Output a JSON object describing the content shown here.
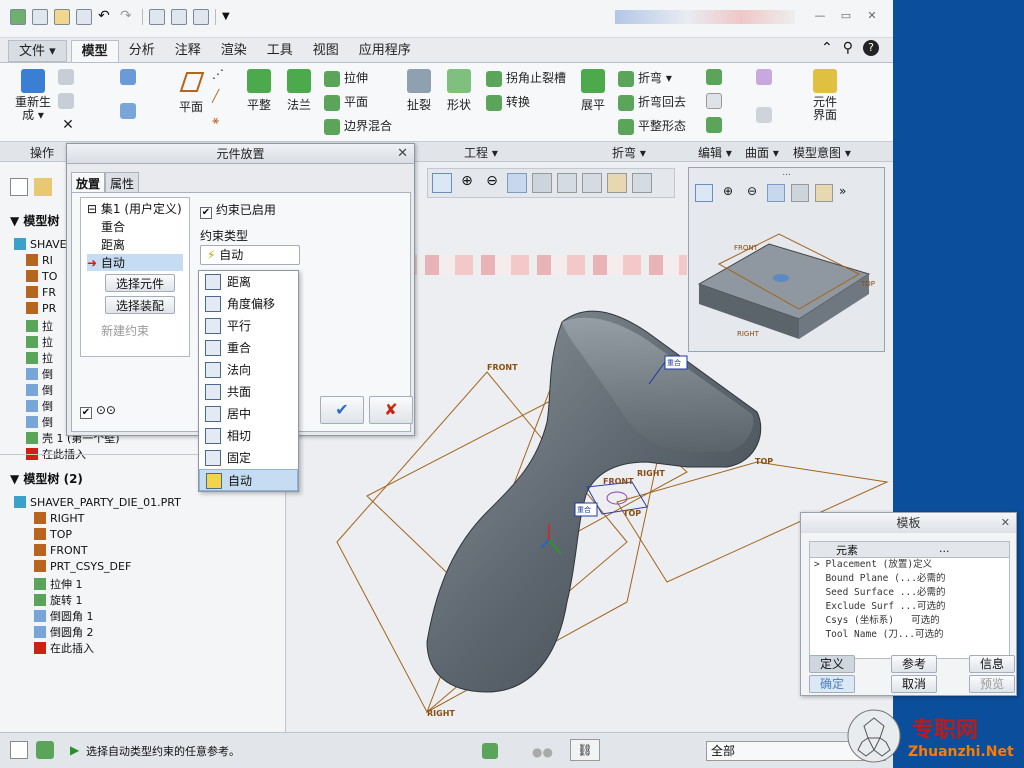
{
  "qat": {
    "save_label": ""
  },
  "menu": {
    "file": "文件 ▾",
    "tabs": [
      "模型",
      "分析",
      "注释",
      "渲染",
      "工具",
      "视图",
      "应用程序"
    ]
  },
  "ribbon": {
    "regen": "重新生\n成 ▾",
    "plane": "平面",
    "flat": "平整",
    "flange": "法兰",
    "extrude": "拉伸",
    "planar": "平面",
    "boundary_blend": "边界混合",
    "rip": "扯裂",
    "shape": "形状",
    "corner_relief": "拐角止裂槽",
    "convert": "转换",
    "unbend": "展平",
    "bend": "折弯 ▾",
    "bend_back": "折弯回去",
    "flatten_form": "平整形态",
    "component_interface": "元件\n界面"
  },
  "groups": {
    "operations": "操作",
    "engineering": "工程 ▾",
    "bend": "折弯 ▾",
    "edit": "编辑 ▾",
    "surface": "曲面 ▾",
    "model_intent": "模型意图 ▾"
  },
  "dialog": {
    "title": "元件放置",
    "tab_placement": "放置",
    "tab_properties": "属性",
    "set_label": "⊟ 集1 (用户定义)",
    "c_coincident": "重合",
    "c_distance": "距离",
    "c_auto": "自动",
    "select_component": "选择元件",
    "select_assembly": "选择装配",
    "new_constraint": "新建约束",
    "constraint_enabled": "约束已启用",
    "constraint_type": "约束类型",
    "type_value": "自动",
    "ok": "✔",
    "cancel": "✘",
    "glasses": "⊙⊙"
  },
  "dropdown": [
    {
      "label": "距离",
      "icon": "distance-icon"
    },
    {
      "label": "角度偏移",
      "icon": "angle-offset-icon"
    },
    {
      "label": "平行",
      "icon": "parallel-icon"
    },
    {
      "label": "重合",
      "icon": "coincident-icon"
    },
    {
      "label": "法向",
      "icon": "normal-icon"
    },
    {
      "label": "共面",
      "icon": "coplanar-icon"
    },
    {
      "label": "居中",
      "icon": "centered-icon"
    },
    {
      "label": "相切",
      "icon": "tangent-icon"
    },
    {
      "label": "固定",
      "icon": "fixed-icon"
    },
    {
      "label": "自动",
      "icon": "auto-icon"
    }
  ],
  "tree1": {
    "header": "▼ 模型树",
    "items": [
      "SHAVER",
      "RI",
      "TO",
      "FR",
      "PR",
      "拉",
      "拉",
      "拉",
      "倒",
      "倒",
      "倒",
      "倒",
      "壳 1 (第一个壁)",
      "在此插入"
    ]
  },
  "tree2": {
    "header": "▼ 模型树 (2)",
    "items": [
      "SHAVER_PARTY_DIE_01.PRT",
      "RIGHT",
      "TOP",
      "FRONT",
      "PRT_CSYS_DEF",
      "拉伸 1",
      "旋转 1",
      "倒圆角 1",
      "倒圆角 2",
      "在此插入"
    ]
  },
  "viewport": {
    "labels": [
      "FRONT",
      "TOP",
      "RIGHT",
      "RIGHT",
      "FRONT",
      "TOP",
      "重合",
      "重合"
    ]
  },
  "mini": {
    "title": "...",
    "labels": [
      "FRONT",
      "TOP",
      "RIGHT"
    ],
    "more": "»"
  },
  "template": {
    "title": "模板",
    "col1": "元素",
    "col2": "...",
    "rows": [
      "> Placement (放置)定义",
      "  Bound Plane (...必需的",
      "  Seed Surface ...必需的",
      "  Exclude Surf ...可选的",
      "  Csys (坐标系)   可选的",
      "  Tool Name (刀...可选的"
    ],
    "define": "定义",
    "ref": "参考",
    "info": "信息",
    "confirm": "确定",
    "cancel": "取消",
    "preview": "预览"
  },
  "status": {
    "message": "选择自动类型约束的任意参考。",
    "filter": "全部"
  },
  "watermark": {
    "cn": "专职网",
    "url": "Zhuanzhi.Net"
  }
}
